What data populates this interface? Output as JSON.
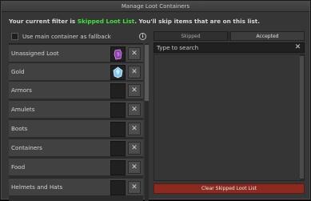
{
  "window": {
    "title": "Manage Loot Containers"
  },
  "info": {
    "prefix": "Your current filter is ",
    "filter_name": "Skipped Loot List",
    "suffix": ". You'll skip items that are on this list."
  },
  "fallback": {
    "label": "Use main container as fallback",
    "checked": false
  },
  "categories": [
    {
      "label": "Unassigned Loot",
      "icon": "purple-bag-icon"
    },
    {
      "label": "Gold",
      "icon": "blue-crystal-icon"
    },
    {
      "label": "Armors",
      "icon": ""
    },
    {
      "label": "Amulets",
      "icon": ""
    },
    {
      "label": "Boots",
      "icon": ""
    },
    {
      "label": "Containers",
      "icon": ""
    },
    {
      "label": "Food",
      "icon": ""
    },
    {
      "label": "Helmets and Hats",
      "icon": ""
    }
  ],
  "tabs": {
    "skipped": "Skipped",
    "accepted": "Accepted",
    "active": "accepted"
  },
  "search": {
    "placeholder": "Type to search",
    "value": ""
  },
  "clear_button": "Clear Skipped Loot List",
  "colors": {
    "highlight": "#3ee43e",
    "clear_button": "#8c2a20"
  }
}
